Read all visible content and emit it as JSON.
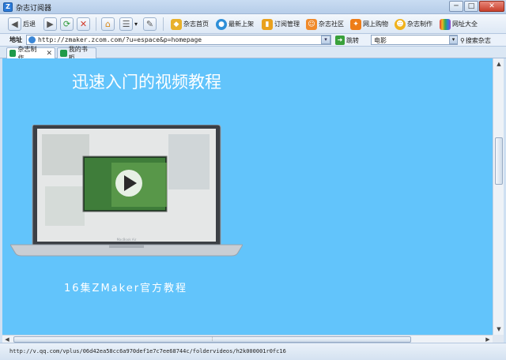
{
  "window": {
    "title": "杂志订阅器",
    "app_icon": "Z"
  },
  "toolbar": {
    "back_label": "后退",
    "items": [
      {
        "name": "magazine-home",
        "label": "杂志首页",
        "color": "#e8b12c"
      },
      {
        "name": "new-arrivals",
        "label": "最新上架",
        "color": "#2e8fd8"
      },
      {
        "name": "subscription-management",
        "label": "订阅管理",
        "color": "#e9a11e"
      },
      {
        "name": "magazine-community",
        "label": "杂志社区",
        "color": "#f08a2b"
      },
      {
        "name": "online-shopping",
        "label": "网上购物",
        "color": "#ee7d18"
      },
      {
        "name": "magazine-making",
        "label": "杂志制作",
        "color": "#f0b21d"
      },
      {
        "name": "url-directory",
        "label": "网址大全",
        "color": "#d84a9b"
      }
    ]
  },
  "address": {
    "label": "地址",
    "url": "http://zmaker.zcom.com/?u=espace&p=homepage",
    "go_label": "跳转",
    "search_value": "电影",
    "search_button": "搜索杂志"
  },
  "tabs": [
    {
      "label": "杂志制作",
      "active": true
    },
    {
      "label": "我的书柜",
      "active": false
    }
  ],
  "content": {
    "heading": "迅速入门的视频教程",
    "caption": "16集ZMaker官方教程",
    "laptop_brand": "MacBook Air",
    "background_color": "#62c4fb"
  },
  "status": {
    "url": "http://v.qq.com/vplus/06d42ea58cc6a970def1e7c7ee68744c/foldervideos/h2k000001r0fc16"
  }
}
